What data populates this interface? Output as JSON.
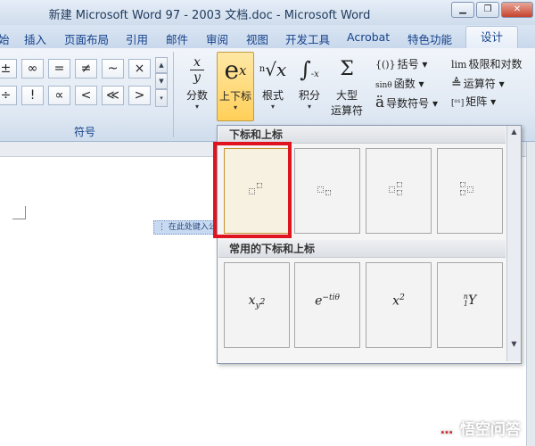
{
  "titlebar": {
    "title": "新建 Microsoft Word 97 - 2003 文档.doc - Microsoft Word",
    "minimize_icon": "minimize-icon",
    "restore_icon": "restore-icon",
    "close_icon": "close-icon"
  },
  "tabs": [
    {
      "label": "始"
    },
    {
      "label": "插入"
    },
    {
      "label": "页面布局"
    },
    {
      "label": "引用"
    },
    {
      "label": "邮件"
    },
    {
      "label": "审阅"
    },
    {
      "label": "视图"
    },
    {
      "label": "开发工具"
    },
    {
      "label": "Acrobat"
    },
    {
      "label": "特色功能"
    },
    {
      "label": "设计",
      "active": true
    }
  ],
  "symbols": {
    "row1": [
      "±",
      "∞",
      "=",
      "≠",
      "~",
      "×"
    ],
    "row2": [
      "÷",
      "!",
      "∝",
      "<",
      "≪",
      ">"
    ],
    "group_label": "符号"
  },
  "structures": {
    "fraction": {
      "label": "分数",
      "glyph": "x/y"
    },
    "script": {
      "label": "上下标",
      "glyph": "eˣ"
    },
    "radical": {
      "label": "根式",
      "glyph": "ⁿ√x"
    },
    "integral": {
      "label": "积分",
      "glyph": "∫"
    },
    "large_operator": {
      "label_line1": "大型",
      "label_line2": "运算符",
      "glyph": "Σ"
    },
    "bracket": {
      "label": "括号",
      "icon_text": "{()}"
    },
    "function": {
      "label": "函数",
      "icon_text": "sinθ"
    },
    "accent": {
      "label": "导数符号",
      "icon_text": "ä"
    },
    "limit_log": {
      "label": "极限和对数",
      "icon_text": "lim"
    },
    "operator": {
      "label": "运算符",
      "icon_text": "≜"
    },
    "matrix": {
      "label": "矩阵",
      "icon_text": "[⁰¹]"
    }
  },
  "gallery": {
    "section1_title": "下标和上标",
    "section2_title": "常用的下标和上标",
    "templates": [
      {
        "name": "superscript",
        "selected": true
      },
      {
        "name": "subscript"
      },
      {
        "name": "subscript-superscript"
      },
      {
        "name": "left-subscript-superscript"
      }
    ],
    "common": [
      {
        "base": "x",
        "sub": "y",
        "sup": "2"
      },
      {
        "base": "e",
        "sup": "−tiθ"
      },
      {
        "base": "x",
        "sup": "2"
      },
      {
        "base": "Y",
        "presup": "n",
        "presub": "1"
      }
    ]
  },
  "document": {
    "placeholder_text": "在此处键入公式"
  },
  "watermark": {
    "text": "悟空问答",
    "icon": "speech-bubble-icon"
  }
}
